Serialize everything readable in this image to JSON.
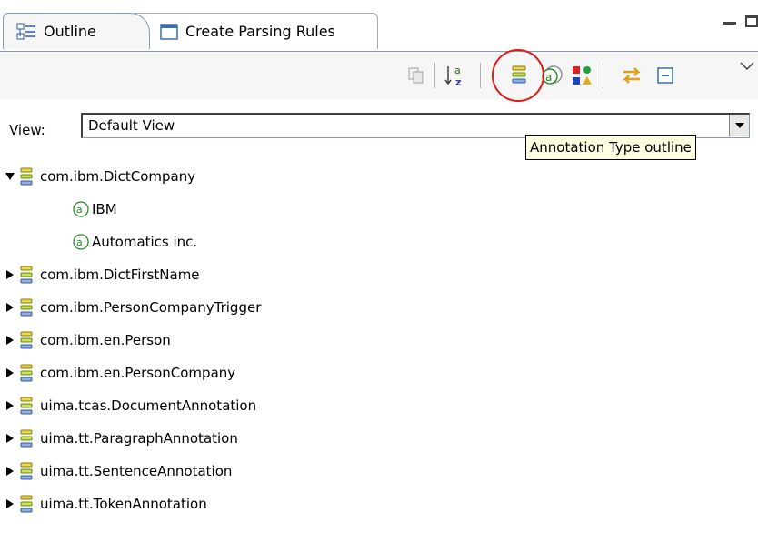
{
  "tabs": [
    {
      "label": "Outline",
      "icon": "outline-icon",
      "active": true
    },
    {
      "label": "Create Parsing Rules",
      "icon": "window-icon",
      "active": false
    }
  ],
  "toolbar": {
    "buttons": [
      "copy-icon",
      "sort-alpha-icon",
      "annotation-type-outline-icon",
      "annotation-outline-icon",
      "color-shapes-icon",
      "link-with-editor-icon",
      "collapse-all-icon"
    ],
    "highlight_color": "#e01818"
  },
  "view": {
    "label": "View:",
    "selected": "Default View"
  },
  "tooltip": "Annotation Type outline",
  "tree": {
    "expanded_type": "com.ibm.DictCompany",
    "annotations": [
      "IBM",
      "Automatics inc."
    ],
    "collapsed_types": [
      "com.ibm.DictFirstName",
      "com.ibm.PersonCompanyTrigger",
      "com.ibm.en.Person",
      "com.ibm.en.PersonCompany",
      "uima.tcas.DocumentAnnotation",
      "uima.tt.ParagraphAnnotation",
      "uima.tt.SentenceAnnotation",
      "uima.tt.TokenAnnotation"
    ]
  }
}
